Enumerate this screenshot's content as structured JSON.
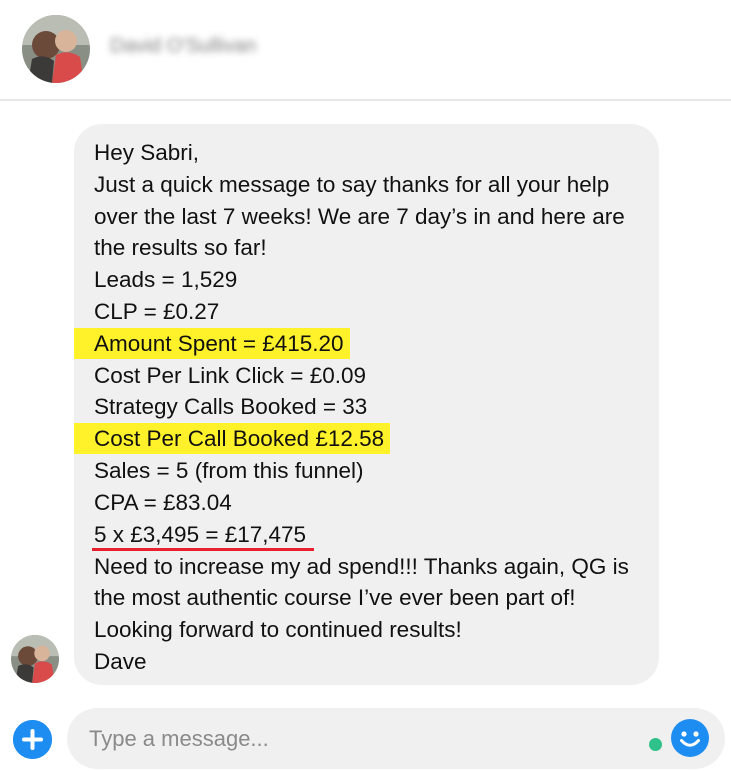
{
  "header": {
    "contact_name": "David O'Sullivan"
  },
  "message": {
    "lines": [
      "Hey Sabri,",
      "Just a quick message to say thanks for all your help",
      "over the last 7 weeks! We are 7 day’s in and here are",
      "the results so far!",
      "Leads = 1,529",
      "CLP = £0.27",
      "Amount Spent = £415.20",
      "Cost Per Link Click  = £0.09",
      "Strategy Calls Booked = 33",
      "Cost Per Call Booked  £12.58",
      "Sales = 5 (from this funnel)",
      "CPA = £83.04",
      "5 x £3,495 = £17,475",
      "Need to increase my ad spend!!! Thanks again, QG is",
      "the most authentic course I’ve ever been part of!",
      "Looking forward to continued results!",
      "Dave"
    ]
  },
  "composer": {
    "placeholder": "Type a message...",
    "add_icon": "plus-icon",
    "emoji_icon": "smiley-icon",
    "online_color": "#2ec28a"
  },
  "colors": {
    "accent": "#1d8df2",
    "highlight": "#fff22a",
    "underline": "#e8202e",
    "bubble": "#f0f0f0"
  }
}
